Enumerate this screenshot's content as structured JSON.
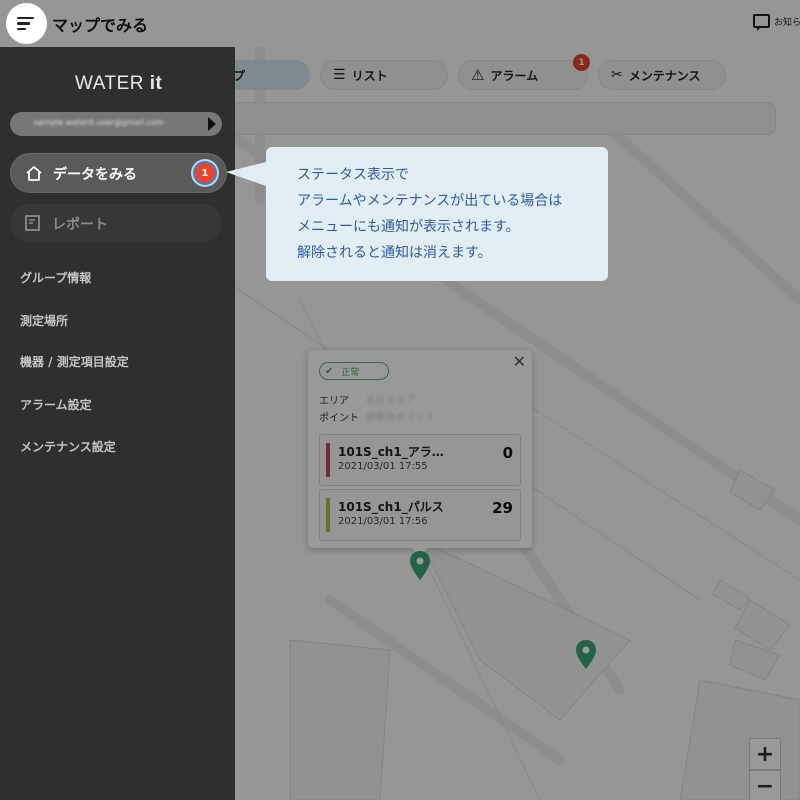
{
  "header": {
    "title": "マップでみる",
    "notice_label": "お知ら"
  },
  "tabs": [
    {
      "label": "プ",
      "icon": "map-icon",
      "active": true
    },
    {
      "label": "リスト",
      "icon": "list-icon",
      "active": false
    },
    {
      "label": "アラーム",
      "icon": "warning-icon",
      "active": false,
      "badge": "1"
    },
    {
      "label": "メンテナンス",
      "icon": "tools-icon",
      "active": false
    }
  ],
  "popup": {
    "status": "正常",
    "area_label": "エリア",
    "area_value": "本社エリア",
    "point_label": "ポイント",
    "point_value": "調整池ポイント",
    "sensors": [
      {
        "name": "101S_ch1_アラ…",
        "time": "2021/03/01 17:55",
        "value": "0",
        "color": "#c0485f"
      },
      {
        "name": "101S_ch1_パルス",
        "time": "2021/03/01 17:56",
        "value": "29",
        "color": "#a6c13f"
      }
    ]
  },
  "zoom": {
    "in": "+",
    "out": "−"
  },
  "drawer": {
    "logo_main": "WATER ",
    "logo_sub": "it",
    "account_email": "sample.waterit.user@gmail.com",
    "nav": [
      {
        "label": "データをみる",
        "icon": "home-icon",
        "badge": "1",
        "active": true
      },
      {
        "label": "レポート",
        "icon": "report-icon",
        "active": false
      }
    ],
    "menu": [
      "グループ情報",
      "測定場所",
      "機器 / 測定項目設定",
      "アラーム設定",
      "メンテナンス設定"
    ]
  },
  "callout": {
    "lines": [
      "ステータス表示で",
      "アラームやメンテナンスが出ている場合は",
      "メニューにも通知が表示されます。",
      "解除されると通知は消えます。"
    ]
  },
  "colors": {
    "drawer_bg": "#2f2f2f",
    "badge": "#e8452a",
    "callout_bg": "#e2eef3",
    "callout_text": "#2a5da5",
    "pin": "#3aa576"
  }
}
